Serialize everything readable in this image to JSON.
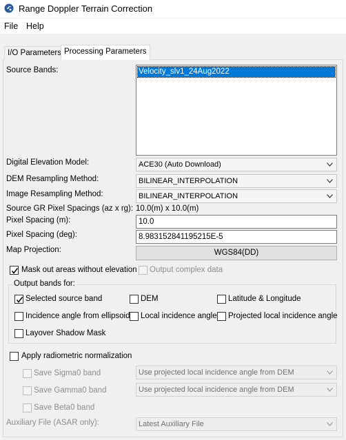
{
  "window": {
    "title": "Range Doppler Terrain Correction"
  },
  "menu": {
    "file": "File",
    "help": "Help"
  },
  "tabs": {
    "io": "I/O Parameters",
    "processing": "Processing Parameters"
  },
  "source_bands": {
    "label": "Source Bands:",
    "items": [
      "Velocity_slv1_24Aug2022"
    ]
  },
  "dem": {
    "label": "Digital Elevation Model:",
    "value": "ACE30 (Auto Download)"
  },
  "dem_resampling": {
    "label": "DEM Resampling Method:",
    "value": "BILINEAR_INTERPOLATION"
  },
  "image_resampling": {
    "label": "Image Resampling Method:",
    "value": "BILINEAR_INTERPOLATION"
  },
  "gr_spacing": {
    "label": "Source GR Pixel Spacings (az x rg):",
    "value": "10.0(m) x 10.0(m)"
  },
  "pixel_spacing_m": {
    "label": "Pixel Spacing (m):",
    "value": "10.0"
  },
  "pixel_spacing_deg": {
    "label": "Pixel Spacing (deg):",
    "value": "8.983152841195215E-5"
  },
  "map_projection": {
    "label": "Map Projection:",
    "value": "WGS84(DD)"
  },
  "mask_no_elevation": {
    "label": "Mask out areas without elevation",
    "checked": true
  },
  "output_complex": {
    "label": "Output complex data",
    "checked": false
  },
  "output_bands": {
    "title": "Output bands for:",
    "selected_source_band": {
      "label": "Selected source band",
      "checked": true
    },
    "dem": {
      "label": "DEM",
      "checked": false
    },
    "lat_lon": {
      "label": "Latitude & Longitude",
      "checked": false
    },
    "incidence_ellipsoid": {
      "label": "Incidence angle from ellipsoid",
      "checked": false
    },
    "local_incidence": {
      "label": "Local incidence angle",
      "checked": false
    },
    "projected_local_incidence": {
      "label": "Projected local incidence angle",
      "checked": false
    },
    "layover_shadow": {
      "label": "Layover Shadow Mask",
      "checked": false
    }
  },
  "radiometric": {
    "label": "Apply radiometric normalization",
    "checked": false,
    "sigma0": {
      "label": "Save Sigma0 band",
      "value": "Use projected local incidence angle from DEM"
    },
    "gamma0": {
      "label": "Save Gamma0 band",
      "value": "Use projected local incidence angle from DEM"
    },
    "beta0": {
      "label": "Save Beta0 band"
    }
  },
  "aux_file": {
    "label": "Auxiliary File (ASAR only):",
    "value": "Latest Auxiliary File"
  }
}
